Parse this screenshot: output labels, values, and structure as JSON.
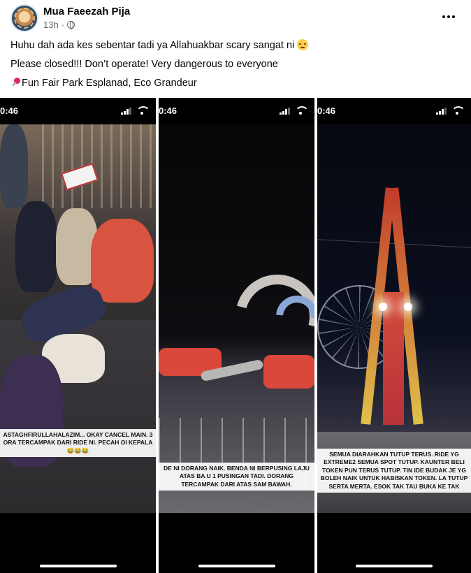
{
  "post": {
    "author": "Mua Faeezah Pija",
    "time": "13h",
    "privacy_icon": "globe-icon",
    "more_icon": "more-options-icon",
    "lines": [
      "Huhu dah ada kes sebentar tadi ya Allahuakbar scary sangat ni",
      "Please closed!!! Don’t operate! Very dangerous to everyone",
      "Fun Fair Park Esplanad, Eco Grandeur"
    ]
  },
  "panels": [
    {
      "status_time": "0:46",
      "caption": "ASTAGHFIRULLAHALAZIM... OKAY CANCEL MAIN. 3 ORA TERCAMPAK DARI RIDE NI. PECAH OI KEPALA 😂😂😂"
    },
    {
      "status_time": "0:46",
      "caption": "DE NI DORANG NAIK. BENDA NI BERPUSING LAJU ATAS BA U 1 PUSINGAN TADI. DORANG TERCAMPAK DARI ATAS SAM BAWAH."
    },
    {
      "status_time": "0:46",
      "caption": "SEMUA DIARAHKAN TUTUP TERUS. RIDE YG EXTREME2 SEMUA SPOT TUTUP. KAUNTER BELI TOKEN PUN TERUS TUTUP. TIN IDE BUDAK JE YG BOLEH NAIK UNTUK HABISKAN TOKEN. LA TUTUP SERTA MERTA. ESOK TAK TAU BUKA KE TAK"
    }
  ],
  "colors": {
    "text": "#050505",
    "meta": "#65676b",
    "panel_bg": "#000000"
  }
}
